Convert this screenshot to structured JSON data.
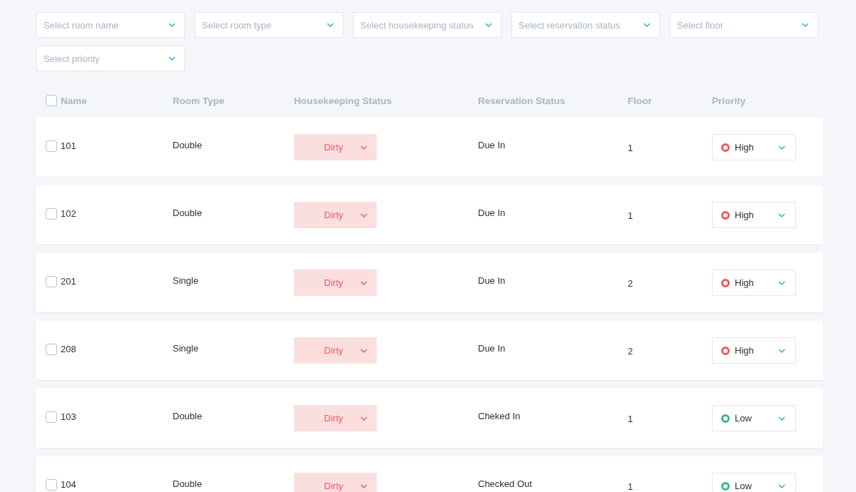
{
  "filters": [
    {
      "placeholder": "Select room name"
    },
    {
      "placeholder": "Select room type"
    },
    {
      "placeholder": "Select housekeeping status"
    },
    {
      "placeholder": "Select reservation status"
    },
    {
      "placeholder": "Select floor"
    },
    {
      "placeholder": "Select priority"
    }
  ],
  "table": {
    "select_all_checked": false,
    "columns": [
      "Name",
      "Room Type",
      "Housekeeping Status",
      "Reservation Status",
      "Floor",
      "Priority"
    ],
    "rows": [
      {
        "checked": false,
        "name": "101",
        "room_type": "Double",
        "housekeeping": "Dirty",
        "reservation": "Due In",
        "floor": "1",
        "priority": "High",
        "color": "#e85d5d"
      },
      {
        "checked": false,
        "name": "102",
        "room_type": "Double",
        "housekeeping": "Dirty",
        "reservation": "Due In",
        "floor": "1",
        "priority": "High",
        "color": "#e85d5d"
      },
      {
        "checked": false,
        "name": "201",
        "room_type": "Single",
        "housekeeping": "Dirty",
        "reservation": "Due In",
        "floor": "2",
        "priority": "High",
        "color": "#e85d5d"
      },
      {
        "checked": false,
        "name": "208",
        "room_type": "Single",
        "housekeeping": "Dirty",
        "reservation": "Due In",
        "floor": "2",
        "priority": "High",
        "color": "#e85d5d"
      },
      {
        "checked": false,
        "name": "103",
        "room_type": "Double",
        "housekeeping": "Dirty",
        "reservation": "Cheked In",
        "floor": "1",
        "priority": "Low",
        "color": "#3fb58e"
      },
      {
        "checked": false,
        "name": "104",
        "room_type": "Double",
        "housekeeping": "Dirty",
        "reservation": "Checked Out",
        "floor": "1",
        "priority": "Low",
        "color": "#3fb58e"
      }
    ]
  }
}
